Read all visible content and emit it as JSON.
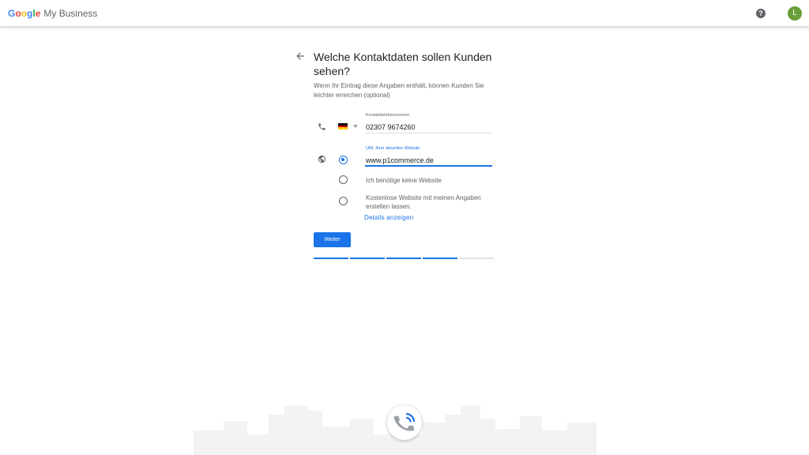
{
  "header": {
    "logo_google_letters": [
      {
        "char": "G",
        "color": "#4285F4"
      },
      {
        "char": "o",
        "color": "#EA4335"
      },
      {
        "char": "o",
        "color": "#FBBC05"
      },
      {
        "char": "g",
        "color": "#4285F4"
      },
      {
        "char": "l",
        "color": "#34A853"
      },
      {
        "char": "e",
        "color": "#EA4335"
      }
    ],
    "product_name": "My Business",
    "help_glyph": "?",
    "help_icon": "help-circle-icon",
    "avatar_initial": "L",
    "avatar_color": "#689f38"
  },
  "form": {
    "back_icon": "arrow-back-icon",
    "title": "Welche Kontaktdaten sollen Kunden sehen?",
    "subtitle": "Wenn Ihr Eintrag diese Angaben enthält, können Kunden Sie leichter erreichen (optional)",
    "phone": {
      "icon": "phone-icon",
      "country_flag": "germany-flag-icon",
      "label": "Kontakttelefonnummer",
      "value": "02307 9674260"
    },
    "website": {
      "icon": "globe-icon",
      "label": "URL Ihrer aktuellen Website",
      "value": "www.p1commerce.de",
      "options": [
        {
          "label": "URL Ihrer aktuellen Website",
          "checked": true
        },
        {
          "label": "Ich benötige keine Website",
          "checked": false
        },
        {
          "label": "Kostenlose Website mit meinen Angaben erstellen lassen.",
          "checked": false
        }
      ],
      "details_link": "Details anzeigen"
    },
    "next_button": "Weiter",
    "progress": {
      "steps_total": 5,
      "steps_done": 4
    }
  },
  "colors": {
    "accent": "#1a73e8",
    "text_primary": "#202124",
    "text_secondary": "#5f6368"
  }
}
